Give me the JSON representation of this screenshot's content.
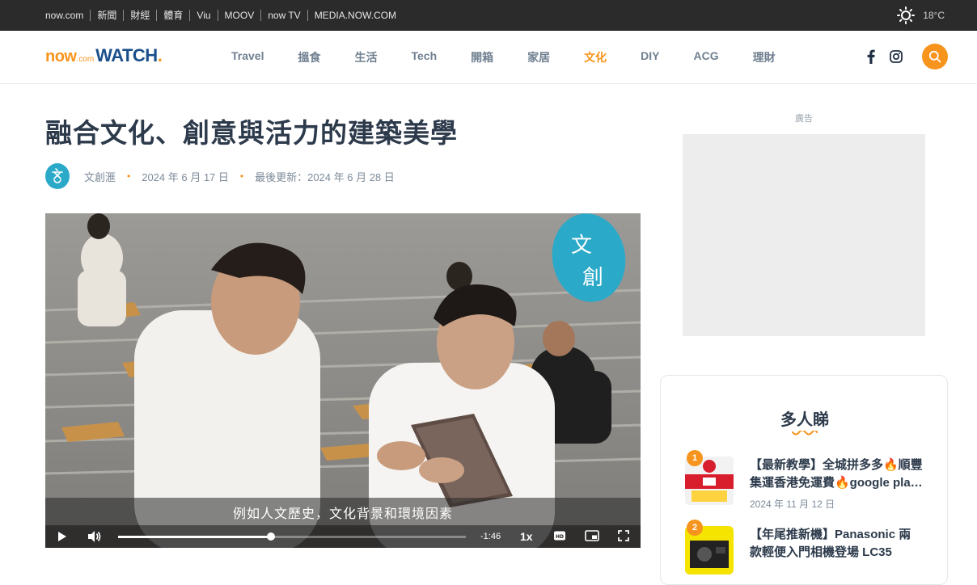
{
  "topbar": {
    "links": [
      "now.com",
      "新聞",
      "財經",
      "體育",
      "Viu",
      "MOOV",
      "now TV",
      "MEDIA.NOW.COM"
    ],
    "weather_icon": "sun-icon",
    "temperature": "18°C"
  },
  "header": {
    "logo": {
      "now": "now",
      "com": ".com",
      "watch": "WATCH",
      "dot": "."
    },
    "nav": [
      "Travel",
      "搵食",
      "生活",
      "Tech",
      "開箱",
      "家居",
      "文化",
      "DIY",
      "ACG",
      "理財"
    ],
    "active_nav": "文化",
    "social_icons": [
      "facebook-icon",
      "instagram-icon"
    ],
    "search_icon": "search-icon"
  },
  "article": {
    "title": "融合文化、創意與活力的建築美學",
    "author": "文創滙",
    "published": "2024 年 6 月 17 日",
    "updated": "最後更新：2024 年 6 月 28 日"
  },
  "video": {
    "subtitle": "例如人文歷史，文化背景和環境因素",
    "time_remaining": "-1:46",
    "speed": "1x",
    "progress": 0.44,
    "watermark": "文創"
  },
  "sidebar": {
    "ad_label": "廣告",
    "popular_title": "多人睇",
    "items": [
      {
        "rank": "1",
        "title_line1": "【最新教學】全城拼多多🔥順豐",
        "title_line2": "集運香港免運費🔥google pla…",
        "date": "2024 年 11 月 12 日"
      },
      {
        "rank": "2",
        "title_line1": "【年尾推新機】Panasonic 兩",
        "title_line2": "款輕便入門相機登場 LC35",
        "date": ""
      }
    ]
  },
  "colors": {
    "accent": "#f7941d",
    "brand_blue": "#1b4f8c",
    "topbar_bg": "#2b2b2b",
    "heading": "#2c3a4b"
  }
}
